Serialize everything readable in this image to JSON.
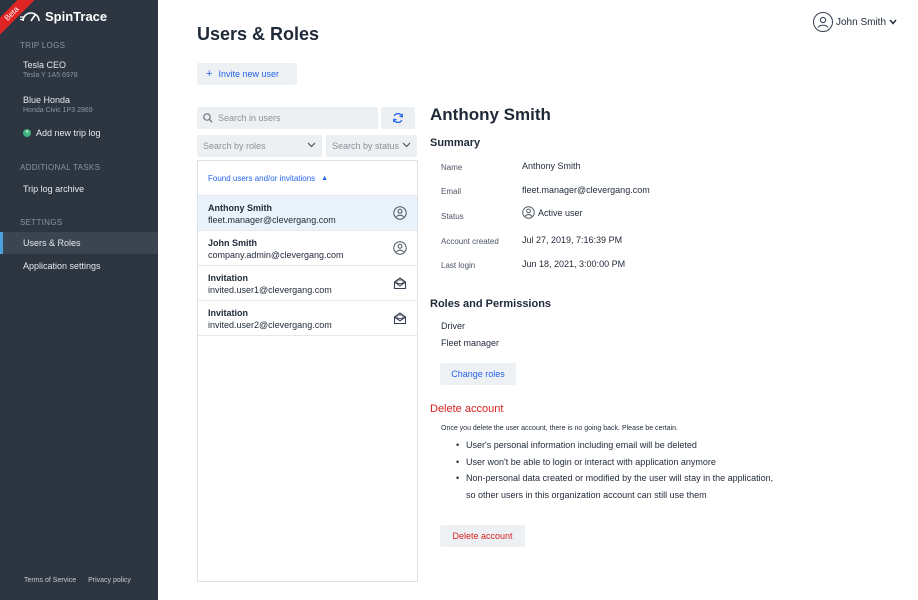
{
  "app": {
    "name": "SpinTrace",
    "badge": "Beta"
  },
  "sidebar": {
    "trip_logs_heading": "TRIP LOGS",
    "trips": [
      {
        "name": "Tesla CEO",
        "vehicle": "Tesla Y 1A5 6978"
      },
      {
        "name": "Blue Honda",
        "vehicle": "Honda Civic 1P3 2869"
      }
    ],
    "add_trip_label": "Add new trip log",
    "additional_heading": "ADDITIONAL TASKS",
    "archive_label": "Trip log archive",
    "settings_heading": "SETTINGS",
    "users_roles_label": "Users & Roles",
    "app_settings_label": "Application settings",
    "terms_label": "Terms of Service",
    "privacy_label": "Privacy policy"
  },
  "header": {
    "title": "Users & Roles",
    "user_name": "John Smith"
  },
  "invite_label": "Invite new user",
  "list": {
    "search_placeholder": "Search in users",
    "roles_placeholder": "Search by roles",
    "status_placeholder": "Search by status",
    "header_label": "Found users and/or invitations",
    "items": [
      {
        "name": "Anthony Smith",
        "email": "fleet.manager@clevergang.com",
        "icon": "user-icon"
      },
      {
        "name": "John Smith",
        "email": "company.admin@clevergang.com",
        "icon": "user-icon"
      },
      {
        "name": "Invitation",
        "email": "invited.user1@clevergang.com",
        "icon": "envelope-open-icon"
      },
      {
        "name": "Invitation",
        "email": "invited.user2@clevergang.com",
        "icon": "envelope-open-icon"
      }
    ]
  },
  "detail": {
    "name": "Anthony Smith",
    "summary_title": "Summary",
    "fields": {
      "name_label": "Name",
      "name_value": "Anthony Smith",
      "email_label": "Email",
      "email_value": "fleet.manager@clevergang.com",
      "status_label": "Status",
      "status_value": "Active user",
      "created_label": "Account created",
      "created_value": "Jul 27, 2019, 7:16:39 PM",
      "login_label": "Last login",
      "login_value": "Jun 18, 2021, 3:00:00 PM"
    },
    "roles_title": "Roles and Permissions",
    "roles": [
      "Driver",
      "Fleet manager"
    ],
    "change_roles_label": "Change roles",
    "delete_title": "Delete account",
    "delete_warning": "Once you delete the user account, there is no going back. Please be certain.",
    "delete_bullets": [
      "User's personal information including email will be deleted",
      "User won't be able to login or interact with application anymore",
      "Non-personal data created or modified by the user will stay in the application,",
      "so other users in this organization account can still use them"
    ],
    "delete_button_label": "Delete account"
  },
  "colors": {
    "sidebar": "#2d3540",
    "accent": "#2563eb",
    "danger": "#d61f1f",
    "beta": "#e02424"
  }
}
